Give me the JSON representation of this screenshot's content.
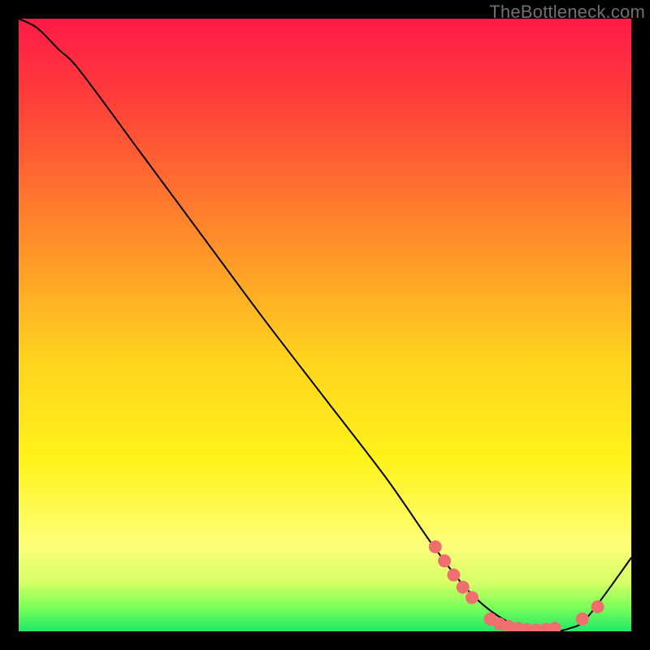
{
  "attribution": "TheBottleneck.com",
  "chart_data": {
    "type": "line",
    "title": "",
    "xlabel": "",
    "ylabel": "",
    "xlim": [
      0,
      100
    ],
    "ylim": [
      0,
      100
    ],
    "grid": false,
    "legend": false,
    "background_gradient": {
      "stops": [
        {
          "offset": 0.0,
          "color": "#ff1a47"
        },
        {
          "offset": 0.12,
          "color": "#ff3b3b"
        },
        {
          "offset": 0.35,
          "color": "#ff8a2a"
        },
        {
          "offset": 0.55,
          "color": "#ffd21f"
        },
        {
          "offset": 0.72,
          "color": "#fff31a"
        },
        {
          "offset": 0.86,
          "color": "#fdff7a"
        },
        {
          "offset": 0.92,
          "color": "#d6ff66"
        },
        {
          "offset": 0.96,
          "color": "#7dff5a"
        },
        {
          "offset": 1.0,
          "color": "#1fe867"
        }
      ]
    },
    "series": [
      {
        "name": "curve",
        "color": "#000000",
        "stroke_width": 2.0,
        "x": [
          0.0,
          3.0,
          6.5,
          10.0,
          20.0,
          30.0,
          40.0,
          50.0,
          60.0,
          68.0,
          74.0,
          80.0,
          86.0,
          90.0,
          93.0,
          100.0
        ],
        "y": [
          100.0,
          98.5,
          95.0,
          91.5,
          78.0,
          64.5,
          51.0,
          38.0,
          25.0,
          13.5,
          6.0,
          1.5,
          0.0,
          0.5,
          2.5,
          12.0
        ]
      }
    ],
    "markers": {
      "color": "#ef6f6f",
      "radius": 8,
      "points": [
        {
          "x": 68.0,
          "y": 13.8
        },
        {
          "x": 69.5,
          "y": 11.5
        },
        {
          "x": 71.0,
          "y": 9.2
        },
        {
          "x": 72.5,
          "y": 7.2
        },
        {
          "x": 74.0,
          "y": 5.5
        },
        {
          "x": 77.0,
          "y": 2.0
        },
        {
          "x": 78.5,
          "y": 1.2
        },
        {
          "x": 80.0,
          "y": 0.8
        },
        {
          "x": 81.5,
          "y": 0.5
        },
        {
          "x": 83.0,
          "y": 0.3
        },
        {
          "x": 84.5,
          "y": 0.2
        },
        {
          "x": 86.0,
          "y": 0.3
        },
        {
          "x": 87.5,
          "y": 0.5
        },
        {
          "x": 92.0,
          "y": 2.0
        },
        {
          "x": 94.5,
          "y": 4.0
        }
      ]
    }
  }
}
